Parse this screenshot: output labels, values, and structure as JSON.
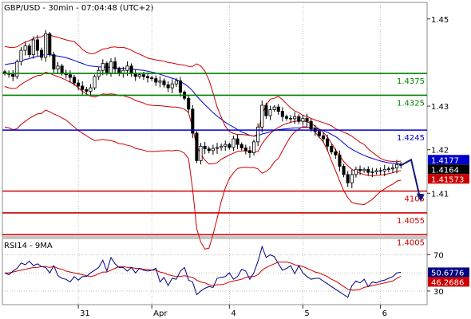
{
  "chart_data": [
    {
      "type": "candlestick",
      "title": "GBP/USD - 30min - 07:04:48 (UTC+2)",
      "ylim": [
        1.4,
        1.4538
      ],
      "y_ticks": [
        "1.45",
        "1.43",
        "1.42",
        "1.41"
      ],
      "y_tick_values": [
        1.45,
        1.43,
        1.42,
        1.41
      ],
      "x_ticks": [
        "31",
        "Apr",
        "4",
        "5",
        "6"
      ],
      "x_tick_index": [
        18,
        36,
        55,
        73,
        92
      ],
      "bar_count": 98,
      "levels": [
        {
          "label": "1.4375",
          "value": 1.4375,
          "color": "#008000"
        },
        {
          "label": "1.4325",
          "value": 1.4325,
          "color": "#008000"
        },
        {
          "label": "1.4245",
          "value": 1.4245,
          "color": "#0000cc"
        },
        {
          "label": "4105",
          "value": 1.4105,
          "color": "#cc0000"
        },
        {
          "label": "1.4055",
          "value": 1.4055,
          "color": "#cc0000"
        },
        {
          "label": "1.4005",
          "value": 1.4005,
          "color": "#cc0000"
        }
      ],
      "price_badges": [
        {
          "label": "1.4177",
          "value": 1.4177,
          "bg": "#0000cc",
          "fg": "#ffffff"
        },
        {
          "label": "1.4164",
          "value": 1.4164,
          "bg": "#000000",
          "fg": "#ffffff"
        },
        {
          "label": "1.41573",
          "value": 1.41573,
          "bg": "#cc0000",
          "fg": "#ffffff"
        }
      ],
      "close": [
        1.4375,
        1.4373,
        1.4368,
        1.4402,
        1.4428,
        1.4438,
        1.4418,
        1.4452,
        1.4428,
        1.4412,
        1.4466,
        1.4418,
        1.4385,
        1.4392,
        1.4376,
        1.4372,
        1.4366,
        1.4353,
        1.4346,
        1.4338,
        1.4334,
        1.4342,
        1.4368,
        1.4382,
        1.4398,
        1.4376,
        1.4402,
        1.4385,
        1.4375,
        1.4382,
        1.4392,
        1.4375,
        1.4368,
        1.4372,
        1.4368,
        1.4365,
        1.4363,
        1.4355,
        1.4358,
        1.4349,
        1.4342,
        1.4351,
        1.4358,
        1.4332,
        1.4318,
        1.4293,
        1.4238,
        1.4175,
        1.4208,
        1.4202,
        1.4198,
        1.4203,
        1.4205,
        1.4208,
        1.4212,
        1.4205,
        1.4225,
        1.4212,
        1.4204,
        1.4198,
        1.4193,
        1.4218,
        1.4252,
        1.4302,
        1.4278,
        1.4292,
        1.4298,
        1.4288,
        1.4276,
        1.4272,
        1.4271,
        1.4276,
        1.4265,
        1.4272,
        1.4265,
        1.4248,
        1.4242,
        1.4232,
        1.4225,
        1.4208,
        1.4195,
        1.4188,
        1.4162,
        1.4143,
        1.4124,
        1.4143,
        1.4155,
        1.4152,
        1.4155,
        1.4148,
        1.4149,
        1.4152,
        1.4151,
        1.4155,
        1.4156,
        1.4158,
        1.4166,
        1.4164
      ],
      "forecast": [
        [
          97,
          1.4164
        ],
        [
          99.5,
          1.4177
        ],
        [
          101.8,
          1.4085
        ]
      ],
      "series": [
        {
          "name": "",
          "color": "#0000cc",
          "values": [
            1.4395,
            1.4397,
            1.4398,
            1.4401,
            1.4404,
            1.4407,
            1.4409,
            1.4412,
            1.4414,
            1.4416,
            1.4419,
            1.4418,
            1.4416,
            1.4415,
            1.4413,
            1.4411,
            1.4408,
            1.4405,
            1.4401,
            1.4398,
            1.4394,
            1.4392,
            1.4391,
            1.439,
            1.439,
            1.4389,
            1.4389,
            1.4388,
            1.4387,
            1.4387,
            1.4386,
            1.4385,
            1.4384,
            1.4383,
            1.4382,
            1.438,
            1.4378,
            1.4376,
            1.4373,
            1.437,
            1.4367,
            1.4364,
            1.4361,
            1.4356,
            1.4351,
            1.4344,
            1.4335,
            1.4323,
            1.4313,
            1.4303,
            1.4294,
            1.4285,
            1.4277,
            1.427,
            1.4263,
            1.4257,
            1.4252,
            1.4246,
            1.4241,
            1.4237,
            1.4233,
            1.4231,
            1.4232,
            1.4236,
            1.4238,
            1.4241,
            1.4244,
            1.4246,
            1.4247,
            1.4248,
            1.4249,
            1.425,
            1.425,
            1.4251,
            1.4251,
            1.425,
            1.4249,
            1.4247,
            1.4244,
            1.424,
            1.4235,
            1.423,
            1.4223,
            1.4215,
            1.4207,
            1.4201,
            1.4196,
            1.4191,
            1.4187,
            1.4183,
            1.418,
            1.4177,
            1.4174,
            1.4172,
            1.417,
            1.4169,
            1.4168,
            1.4167
          ]
        },
        {
          "name": "",
          "color": "#cc0000",
          "values": [
            1.4437,
            1.4435,
            1.4434,
            1.4436,
            1.4442,
            1.4447,
            1.445,
            1.4455,
            1.4458,
            1.4459,
            1.4465,
            1.4463,
            1.446,
            1.4458,
            1.4455,
            1.4452,
            1.445,
            1.4448,
            1.444,
            1.443,
            1.4424,
            1.442,
            1.4421,
            1.4426,
            1.4431,
            1.4432,
            1.4435,
            1.4436,
            1.4434,
            1.4435,
            1.4432,
            1.4428,
            1.4423,
            1.4419,
            1.4415,
            1.441,
            1.4408,
            1.4406,
            1.4405,
            1.4403,
            1.44,
            1.4399,
            1.4397,
            1.4395,
            1.4394,
            1.4391,
            1.4391,
            1.4397,
            1.4392,
            1.438,
            1.436,
            1.433,
            1.4298,
            1.4275,
            1.4254,
            1.4242,
            1.4237,
            1.4235,
            1.4235,
            1.4234,
            1.4233,
            1.4231,
            1.4236,
            1.4282,
            1.4302,
            1.4316,
            1.4318,
            1.4322,
            1.4315,
            1.4305,
            1.4296,
            1.4289,
            1.4285,
            1.4279,
            1.4276,
            1.4272,
            1.4268,
            1.4265,
            1.4262,
            1.4259,
            1.4255,
            1.4248,
            1.4244,
            1.424,
            1.4236,
            1.4231,
            1.4224,
            1.4217,
            1.4212,
            1.4202,
            1.4194,
            1.4187,
            1.418,
            1.4176,
            1.4174,
            1.4173,
            1.4172,
            1.4174
          ]
        },
        {
          "name": "",
          "color": "#cc0000",
          "values": [
            1.4345,
            1.4342,
            1.434,
            1.4342,
            1.435,
            1.4356,
            1.4361,
            1.4366,
            1.437,
            1.4371,
            1.4378,
            1.4375,
            1.4371,
            1.4368,
            1.4364,
            1.436,
            1.4355,
            1.435,
            1.4342,
            1.4334,
            1.4328,
            1.4323,
            1.4321,
            1.4324,
            1.4328,
            1.4327,
            1.4328,
            1.4327,
            1.4324,
            1.4324,
            1.4321,
            1.4318,
            1.4313,
            1.431,
            1.4307,
            1.4303,
            1.4302,
            1.4301,
            1.4301,
            1.43,
            1.4299,
            1.4298,
            1.4298,
            1.4296,
            1.4293,
            1.4285,
            1.425,
            1.4208,
            1.419,
            1.4176,
            1.4167,
            1.4168,
            1.417,
            1.4178,
            1.4183,
            1.4188,
            1.4192,
            1.4196,
            1.4197,
            1.4197,
            1.4196,
            1.4195,
            1.4196,
            1.4214,
            1.4226,
            1.4237,
            1.4245,
            1.4251,
            1.4256,
            1.426,
            1.4263,
            1.4265,
            1.4266,
            1.4266,
            1.4264,
            1.426,
            1.4254,
            1.4247,
            1.424,
            1.4229,
            1.4215,
            1.42,
            1.4186,
            1.4173,
            1.4163,
            1.4155,
            1.415,
            1.4146,
            1.4143,
            1.4141,
            1.414,
            1.4141,
            1.4142,
            1.4143,
            1.4145,
            1.4147,
            1.415,
            1.4152
          ]
        },
        {
          "name": "",
          "color": "#cc0000",
          "values": [
            1.4252,
            1.425,
            1.4246,
            1.4248,
            1.4258,
            1.4265,
            1.4272,
            1.4277,
            1.4282,
            1.4283,
            1.4291,
            1.4287,
            1.4282,
            1.4278,
            1.4273,
            1.4268,
            1.426,
            1.4252,
            1.4244,
            1.4238,
            1.4232,
            1.4226,
            1.4221,
            1.4222,
            1.4224,
            1.4222,
            1.4221,
            1.4218,
            1.4214,
            1.4213,
            1.421,
            1.4208,
            1.4203,
            1.4201,
            1.4199,
            1.4196,
            1.4196,
            1.4196,
            1.4197,
            1.4197,
            1.4198,
            1.4197,
            1.4199,
            1.4197,
            1.4192,
            1.4179,
            1.4109,
            1.4019,
            1.3988,
            1.3972,
            1.3974,
            1.4006,
            1.4042,
            1.4081,
            1.4112,
            1.4134,
            1.4147,
            1.4157,
            1.4159,
            1.416,
            1.4159,
            1.4159,
            1.4156,
            1.4146,
            1.415,
            1.4158,
            1.4172,
            1.418,
            1.4197,
            1.4215,
            1.423,
            1.4241,
            1.4247,
            1.4253,
            1.4252,
            1.4248,
            1.424,
            1.4229,
            1.4218,
            1.4199,
            1.4175,
            1.4152,
            1.4128,
            1.4106,
            1.409,
            1.4079,
            1.4076,
            1.4075,
            1.4074,
            1.408,
            1.4086,
            1.4095,
            1.4104,
            1.411,
            1.4116,
            1.4121,
            1.4128,
            1.413
          ]
        }
      ]
    },
    {
      "type": "line",
      "title": "RSI14 - 9MA",
      "ylim": [
        15,
        88
      ],
      "y_ticks": [
        "70",
        "30"
      ],
      "y_tick_values": [
        70,
        30
      ],
      "levels": [
        50
      ],
      "x_ticks": [
        "31",
        "Apr",
        "4",
        "5",
        "6"
      ],
      "x_tick_index": [
        18,
        36,
        55,
        73,
        92
      ],
      "price_badges": [
        {
          "label": "50.6776",
          "value": 50.6776,
          "bg": "#000080",
          "fg": "#ffffff"
        },
        {
          "label": "46.2686",
          "value": 46.2686,
          "bg": "#cc0000",
          "fg": "#ffffff"
        }
      ],
      "series": [
        {
          "name": "RSI14",
          "color": "#000080",
          "values": [
            50,
            48,
            52,
            55,
            61,
            59,
            63,
            58,
            60,
            57,
            56,
            50,
            58,
            47,
            44,
            43,
            40,
            46,
            42,
            46,
            46,
            50,
            53,
            56,
            64,
            52,
            67,
            60,
            56,
            56,
            52,
            56,
            50,
            55,
            53,
            52,
            53,
            55,
            40,
            45,
            36,
            44,
            43,
            52,
            56,
            42,
            40,
            26,
            30,
            33,
            35,
            34,
            44,
            45,
            46,
            50,
            43,
            46,
            54,
            52,
            43,
            50,
            63,
            79,
            67,
            70,
            68,
            60,
            53,
            55,
            58,
            49,
            58,
            50,
            46,
            43,
            44,
            44,
            41,
            38,
            35,
            32,
            29,
            26,
            23,
            36,
            41,
            39,
            43,
            35,
            40,
            39,
            41,
            42,
            44,
            46,
            50,
            50.68
          ]
        },
        {
          "name": "9MA",
          "color": "#cc0000",
          "values": [
            50,
            50,
            51,
            52,
            53,
            54,
            55,
            56,
            56,
            57,
            57,
            56,
            57,
            55,
            54,
            52,
            51,
            50,
            49,
            48,
            47,
            46,
            47,
            49,
            51,
            51,
            53,
            55,
            57,
            57,
            56,
            56,
            55,
            55,
            54,
            54,
            53,
            53,
            51,
            50,
            48,
            47,
            46,
            46,
            47,
            46,
            45,
            42,
            40,
            39,
            37,
            36,
            37,
            37,
            38,
            40,
            41,
            42,
            43,
            45,
            46,
            46,
            48,
            53,
            56,
            58,
            60,
            62,
            62,
            62,
            61,
            59,
            58,
            57,
            55,
            53,
            51,
            50,
            48,
            46,
            43,
            41,
            38,
            35,
            32,
            31,
            31,
            32,
            34,
            35,
            36,
            37,
            38,
            39,
            40,
            41,
            44,
            46.27
          ]
        }
      ]
    }
  ],
  "colors": {
    "background": "#ffffff",
    "candle": "#000000",
    "band": "#cc0000",
    "moving_average": "#0000cc",
    "support": "#cc0000",
    "resistance": "#008000",
    "pivot": "#0000cc",
    "forecast_arrow": "#0a1a7a"
  }
}
